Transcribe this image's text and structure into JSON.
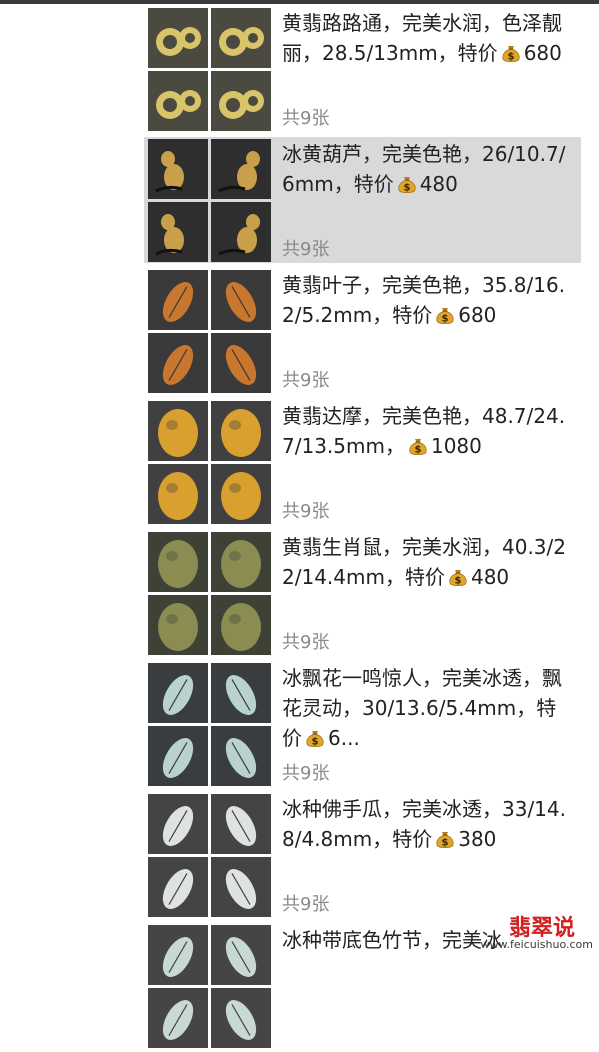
{
  "items": [
    {
      "text_before": "黄翡路路通，完美水润，色泽靓丽，28.5/13mm，特价",
      "text_after": "680",
      "count": "共9张",
      "selected": false,
      "bg": "#4a4a40",
      "fg": "#d9c46a",
      "shape": "ring"
    },
    {
      "text_before": "冰黄葫芦，完美色艳，26/10.7/6mm，特价",
      "text_after": "480",
      "count": "共9张",
      "selected": true,
      "bg": "#2e2e2e",
      "fg": "#c9a04a",
      "shape": "gourd"
    },
    {
      "text_before": "黄翡叶子，完美色艳，35.8/16.2/5.2mm，特价",
      "text_after": "680",
      "count": "共9张",
      "selected": false,
      "bg": "#3a3a3a",
      "fg": "#c9762e",
      "shape": "leaf"
    },
    {
      "text_before": "黄翡达摩，完美色艳，48.7/24.7/13.5mm，",
      "text_after": "1080",
      "count": "共9张",
      "selected": false,
      "bg": "#404040",
      "fg": "#d9a030",
      "shape": "blob"
    },
    {
      "text_before": "黄翡生肖鼠，完美水润，40.3/22/14.4mm，特价",
      "text_after": "480",
      "count": "共9张",
      "selected": false,
      "bg": "#3e4236",
      "fg": "#8a8c52",
      "shape": "blob"
    },
    {
      "text_before": "冰飘花一鸣惊人，完美冰透，飘花灵动，30/13.6/5.4mm，特价",
      "text_after": "6...",
      "count": "共9张",
      "selected": false,
      "bg": "#3a3d40",
      "fg": "#b9d2d0",
      "shape": "leaf"
    },
    {
      "text_before": "冰种佛手瓜，完美冰透，33/14.8/4.8mm，特价",
      "text_after": "380",
      "count": "共9张",
      "selected": false,
      "bg": "#444444",
      "fg": "#dfe3e0",
      "shape": "leaf"
    },
    {
      "text_before": "冰种带底色竹节，完美冰",
      "text_after": "",
      "count": "",
      "selected": false,
      "bg": "#454545",
      "fg": "#c8d8d4",
      "shape": "leaf"
    }
  ],
  "watermark": {
    "title": "翡翠说",
    "url": "www.feicuishuo.com"
  }
}
